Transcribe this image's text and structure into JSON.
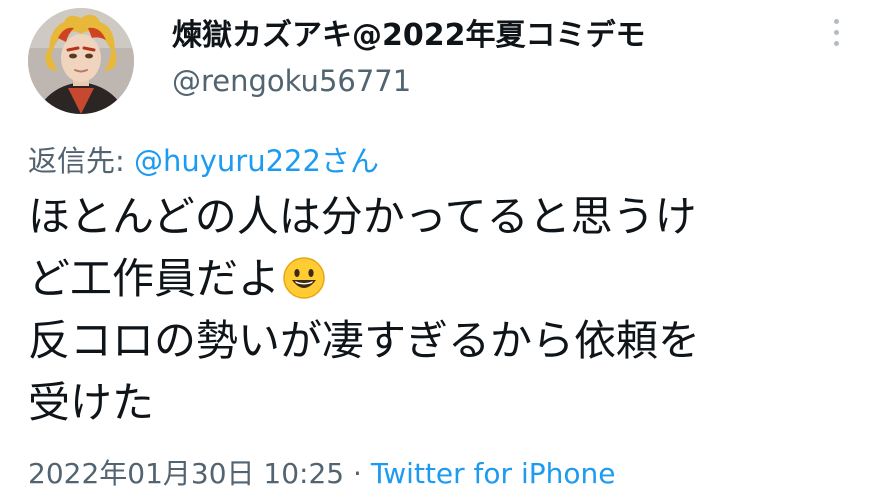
{
  "author": {
    "display_name": "煉獄カズアキ@2022年夏コミデモ",
    "handle": "@rengoku56771",
    "avatar": "cosplay-profile-photo"
  },
  "menu": {
    "icon": "more-vertical-icon"
  },
  "reply": {
    "prefix": "返信先: ",
    "mention": "@huyuru222さん"
  },
  "body": {
    "line1": "ほとんどの人は分かってると思うけ",
    "line2": "ど工作員だよ",
    "line2_emoji": "grinning-face-emoji",
    "line3": "反コロの勢いが凄すぎるから依頼を",
    "line4": "受けた"
  },
  "meta": {
    "timestamp": "2022年01月30日 10:25",
    "separator": " · ",
    "source": "Twitter for iPhone"
  },
  "colors": {
    "link": "#1d9bf0",
    "secondary_text": "#536471",
    "primary_text": "#0f1419"
  }
}
